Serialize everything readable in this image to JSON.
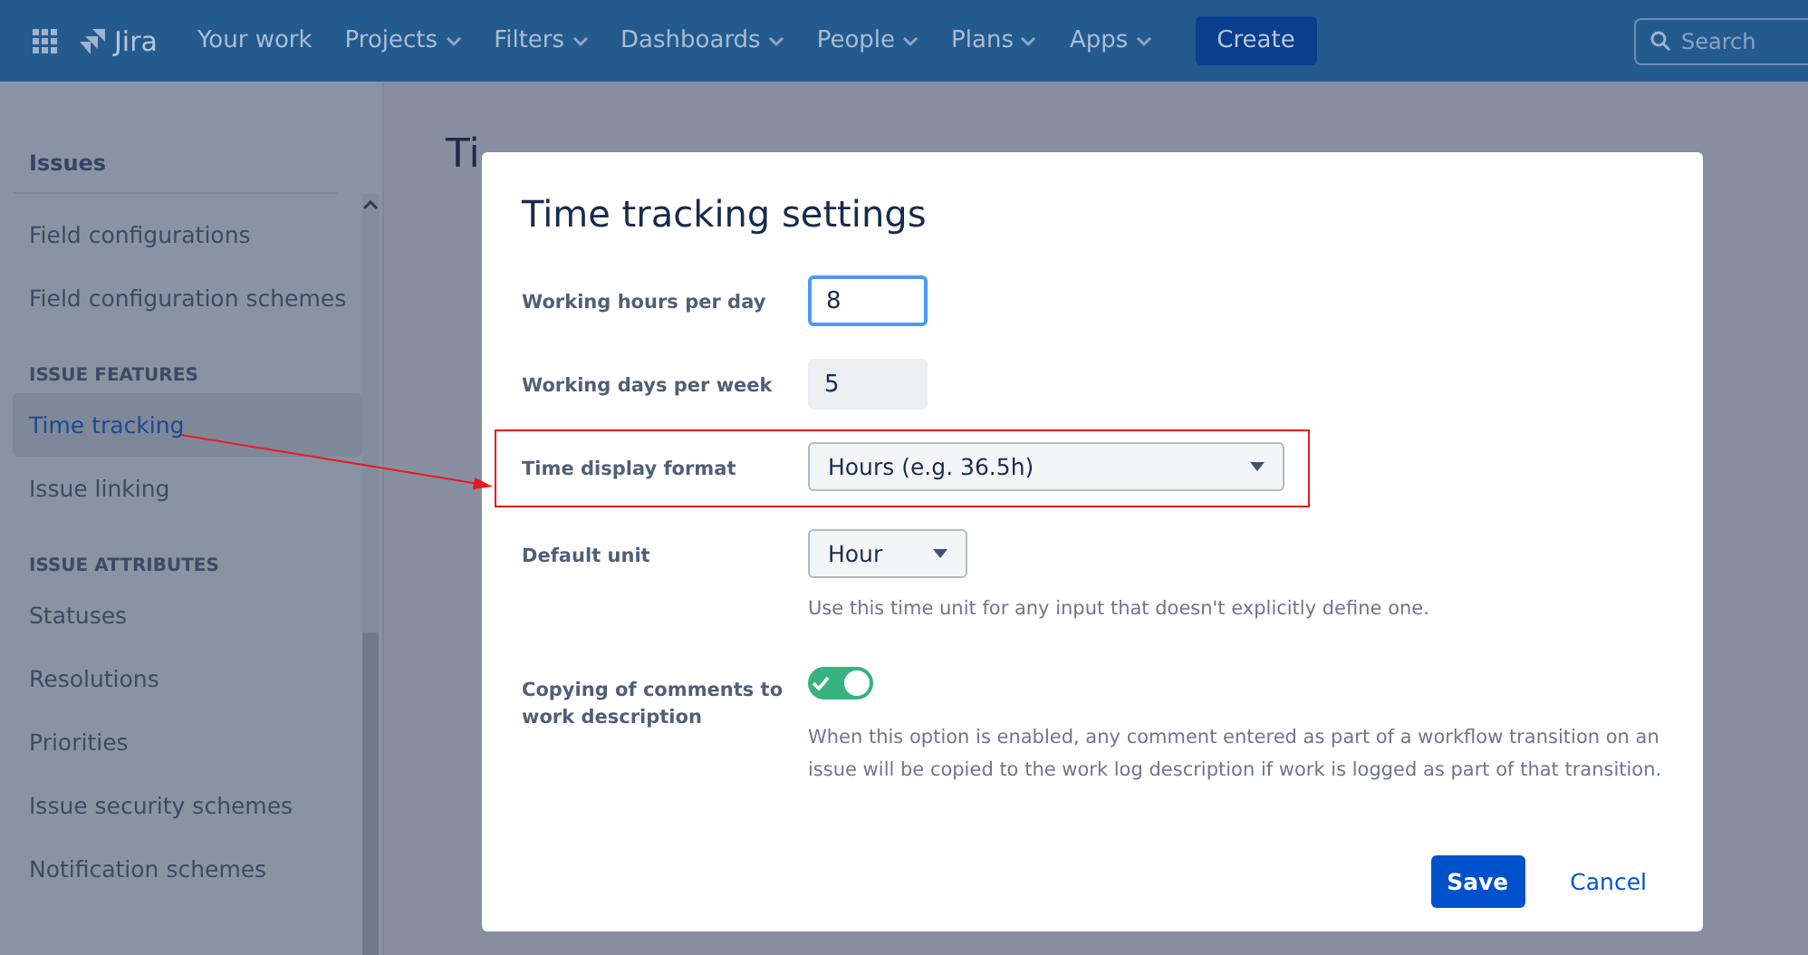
{
  "top_nav": {
    "product": "Jira",
    "items": [
      {
        "label": "Your work",
        "dropdown": false
      },
      {
        "label": "Projects",
        "dropdown": true
      },
      {
        "label": "Filters",
        "dropdown": true
      },
      {
        "label": "Dashboards",
        "dropdown": true
      },
      {
        "label": "People",
        "dropdown": true
      },
      {
        "label": "Plans",
        "dropdown": true
      },
      {
        "label": "Apps",
        "dropdown": true
      }
    ],
    "create_button": "Create",
    "search": {
      "placeholder": "Search"
    }
  },
  "sidebar": {
    "title": "Issues",
    "items": [
      {
        "kind": "item",
        "label": "Field configurations",
        "selected": false
      },
      {
        "kind": "item",
        "label": "Field configuration schemes",
        "selected": false
      },
      {
        "kind": "heading",
        "label": "ISSUE FEATURES"
      },
      {
        "kind": "item",
        "label": "Time tracking",
        "selected": true
      },
      {
        "kind": "item",
        "label": "Issue linking",
        "selected": false
      },
      {
        "kind": "heading",
        "label": "ISSUE ATTRIBUTES"
      },
      {
        "kind": "item",
        "label": "Statuses",
        "selected": false
      },
      {
        "kind": "item",
        "label": "Resolutions",
        "selected": false
      },
      {
        "kind": "item",
        "label": "Priorities",
        "selected": false
      },
      {
        "kind": "item",
        "label": "Issue security schemes",
        "selected": false
      },
      {
        "kind": "item",
        "label": "Notification schemes",
        "selected": false
      }
    ]
  },
  "page": {
    "title": "Ti"
  },
  "dialog": {
    "title": "Time tracking settings",
    "fields": [
      {
        "kind": "input",
        "label": "Working hours per day",
        "value": "8",
        "focused": true,
        "disabled": false
      },
      {
        "kind": "input",
        "label": "Working days per week",
        "value": "5",
        "focused": false,
        "disabled": true
      },
      {
        "kind": "select",
        "label": "Time display format",
        "value": "Hours (e.g. 36.5h)",
        "highlighted": true
      },
      {
        "kind": "select",
        "label": "Default unit",
        "value": "Hour",
        "highlighted": false,
        "help": "Use this time unit for any input that doesn't explicitly define one."
      },
      {
        "kind": "toggle",
        "label": "Copying of comments to work description",
        "on": true,
        "help": "When this option is enabled, any comment entered as part of a workflow transition on an issue will be copied to the work log description if work is logged as part of that transition."
      }
    ],
    "buttons": [
      {
        "label": "Save",
        "kind": "primary"
      },
      {
        "label": "Cancel",
        "kind": "link"
      }
    ]
  }
}
